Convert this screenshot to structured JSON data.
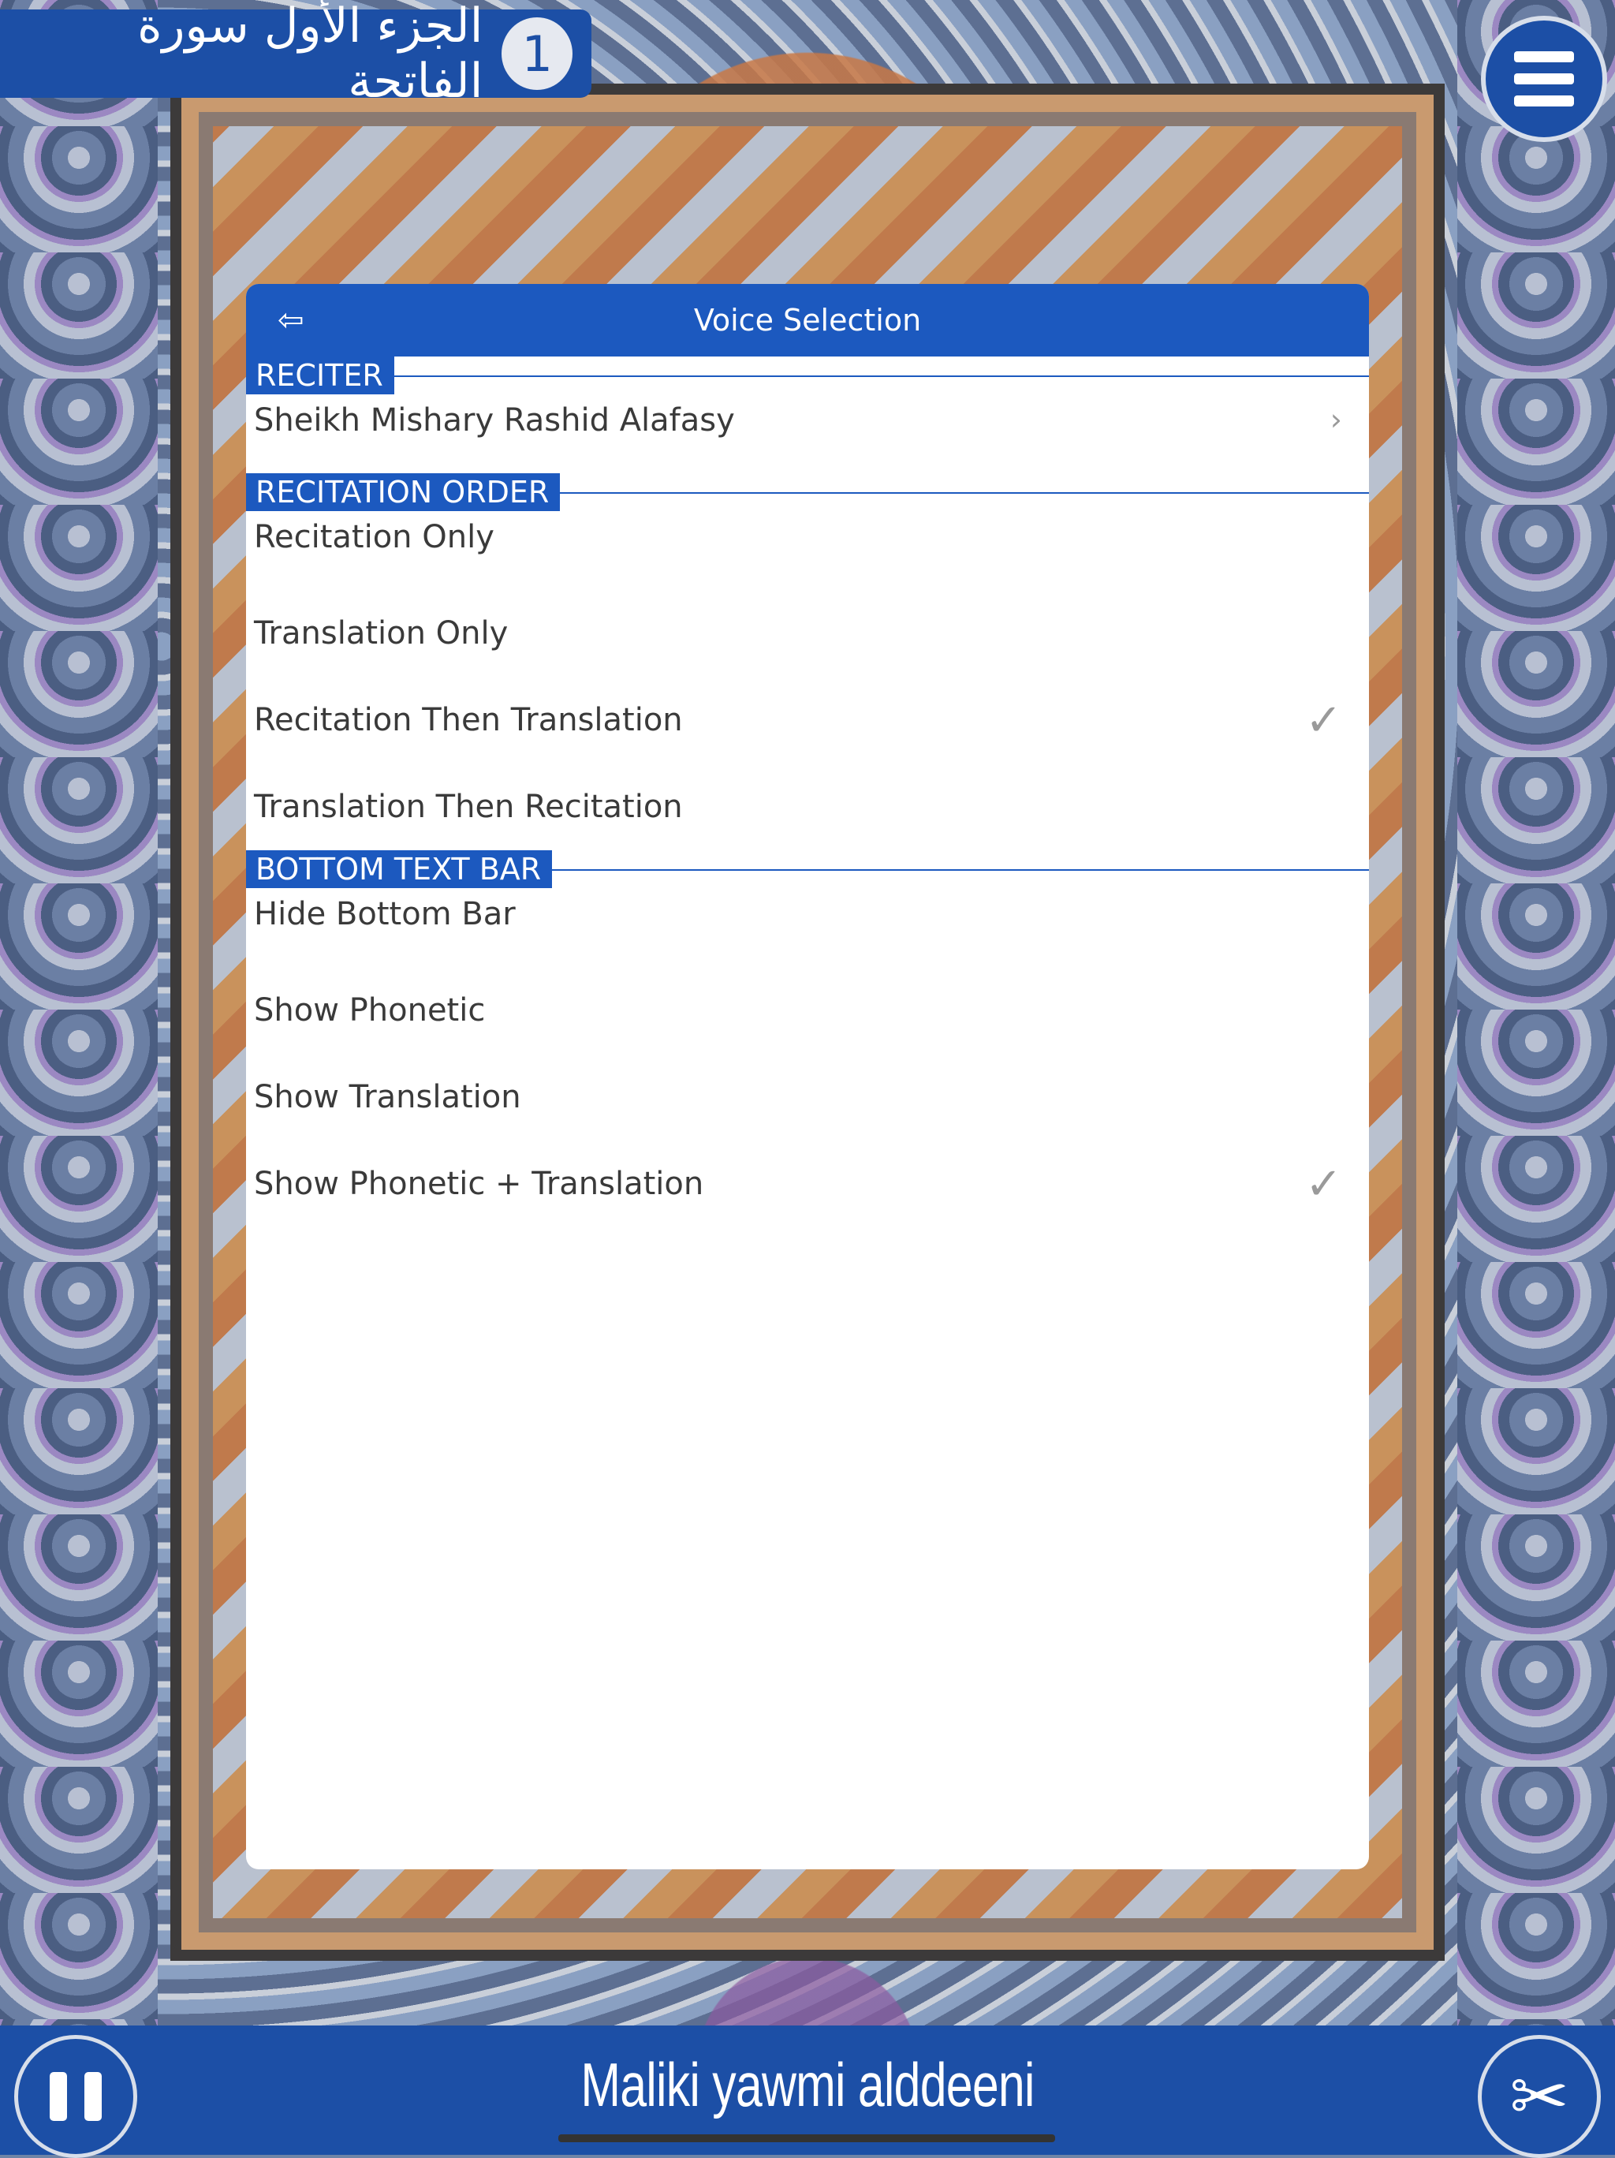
{
  "chapter": {
    "number": "1",
    "arabic_title": "الجزء الأول سورة الفاتحة"
  },
  "modal": {
    "title": "Voice Selection",
    "sections": {
      "reciter": {
        "label": "RECITER",
        "items": [
          {
            "label": "Sheikh Mishary Rashid Alafasy",
            "selected": false,
            "has_chevron": true
          }
        ]
      },
      "recitation_order": {
        "label": "RECITATION ORDER",
        "items": [
          {
            "label": "Recitation Only",
            "selected": false
          },
          {
            "label": "Translation Only",
            "selected": false
          },
          {
            "label": "Recitation Then Translation",
            "selected": true
          },
          {
            "label": "Translation Then Recitation",
            "selected": false
          }
        ]
      },
      "bottom_text_bar": {
        "label": "BOTTOM TEXT BAR",
        "items": [
          {
            "label": "Hide Bottom Bar",
            "selected": false
          },
          {
            "label": "Show Phonetic",
            "selected": false
          },
          {
            "label": "Show Translation",
            "selected": false
          },
          {
            "label": "Show Phonetic + Translation",
            "selected": true
          }
        ]
      }
    }
  },
  "bottom_bar": {
    "phonetic_text": "Maliki yawmi alddeeni"
  },
  "icons": {
    "back": "back-arrow-icon",
    "menu": "hamburger-menu-icon",
    "pause": "pause-icon",
    "tools": "tools-icon",
    "check": "checkmark-icon",
    "chevron": "chevron-right-icon"
  },
  "colors": {
    "accent": "#1c59bf",
    "bar": "#1c4fa6",
    "check": "#9a9a9a"
  }
}
